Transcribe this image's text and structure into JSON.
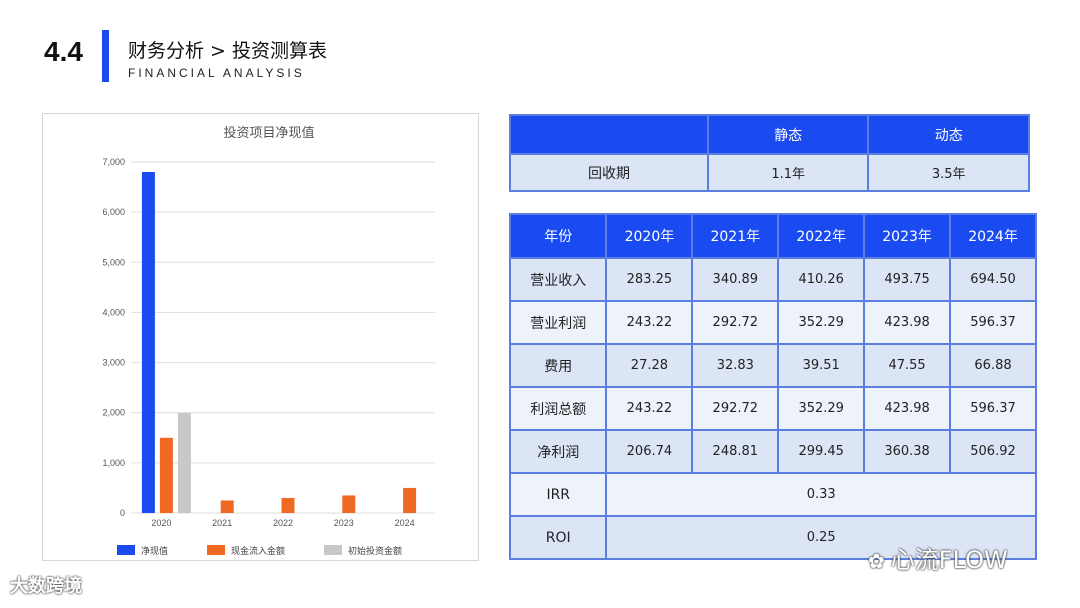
{
  "header": {
    "section_number": "4.4",
    "title": "财务分析 > 投资测算表",
    "subtitle": "FINANCIAL ANALYSIS"
  },
  "colors": {
    "accent": "#1a4bf0",
    "series_npv": "#1a4bf0",
    "series_cash": "#ee6a22",
    "series_init": "#c8c8c8"
  },
  "chart_data": {
    "type": "bar",
    "title": "投资项目净现值",
    "categories": [
      "2020",
      "2021",
      "2022",
      "2023",
      "2024"
    ],
    "series": [
      {
        "name": "净现值",
        "values": [
          6800,
          null,
          null,
          null,
          null
        ]
      },
      {
        "name": "现金流入金额",
        "values": [
          1500,
          250,
          300,
          350,
          500
        ]
      },
      {
        "name": "初始投资金额",
        "values": [
          2000,
          null,
          null,
          null,
          null
        ]
      }
    ],
    "ylim": [
      0,
      7000
    ],
    "yticks": [
      "0",
      "1,000",
      "2,000",
      "3,000",
      "4,000",
      "5,000",
      "6,000",
      "7,000"
    ],
    "grid": true,
    "legend": "bottom"
  },
  "payback_table": {
    "headers": [
      "",
      "静态",
      "动态"
    ],
    "row_label": "回收期",
    "static": "1.1年",
    "dynamic": "3.5年"
  },
  "finance_table": {
    "headers": [
      "年份",
      "2020年",
      "2021年",
      "2022年",
      "2023年",
      "2024年"
    ],
    "rows": [
      {
        "label": "营业收入",
        "values": [
          "283.25",
          "340.89",
          "410.26",
          "493.75",
          "694.50"
        ]
      },
      {
        "label": "营业利润",
        "values": [
          "243.22",
          "292.72",
          "352.29",
          "423.98",
          "596.37"
        ]
      },
      {
        "label": "费用",
        "values": [
          "27.28",
          "32.83",
          "39.51",
          "47.55",
          "66.88"
        ]
      },
      {
        "label": "利润总额",
        "values": [
          "243.22",
          "292.72",
          "352.29",
          "423.98",
          "596.37"
        ]
      },
      {
        "label": "净利润",
        "values": [
          "206.74",
          "248.81",
          "299.45",
          "360.38",
          "506.92"
        ]
      }
    ],
    "irr_label": "IRR",
    "irr_value": "0.33",
    "roi_label": "ROI",
    "roi_value": "0.25"
  },
  "watermarks": {
    "left": "大数跨境",
    "right": "心流FLOW"
  }
}
